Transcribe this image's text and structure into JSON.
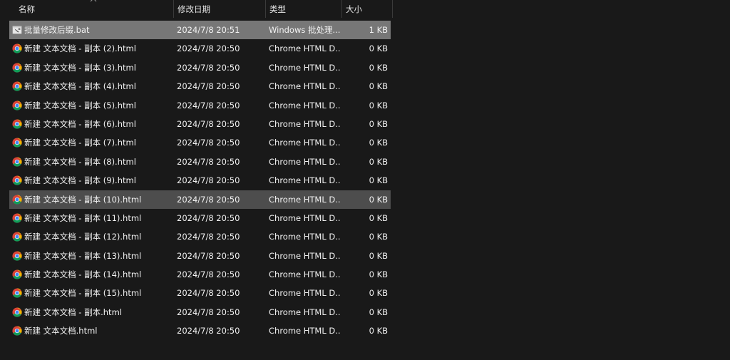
{
  "columns": {
    "name": "名称",
    "date": "修改日期",
    "type": "类型",
    "size": "大小"
  },
  "files": [
    {
      "name": "批量修改后缀.bat",
      "date": "2024/7/8 20:51",
      "type": "Windows 批处理...",
      "size": "1 KB",
      "icon": "bat-file-icon",
      "state": "selected"
    },
    {
      "name": "新建 文本文档 - 副本 (2).html",
      "date": "2024/7/8 20:50",
      "type": "Chrome HTML D...",
      "size": "0 KB",
      "icon": "chrome-icon",
      "state": "normal"
    },
    {
      "name": "新建 文本文档 - 副本 (3).html",
      "date": "2024/7/8 20:50",
      "type": "Chrome HTML D...",
      "size": "0 KB",
      "icon": "chrome-icon",
      "state": "normal"
    },
    {
      "name": "新建 文本文档 - 副本 (4).html",
      "date": "2024/7/8 20:50",
      "type": "Chrome HTML D...",
      "size": "0 KB",
      "icon": "chrome-icon",
      "state": "normal"
    },
    {
      "name": "新建 文本文档 - 副本 (5).html",
      "date": "2024/7/8 20:50",
      "type": "Chrome HTML D...",
      "size": "0 KB",
      "icon": "chrome-icon",
      "state": "normal"
    },
    {
      "name": "新建 文本文档 - 副本 (6).html",
      "date": "2024/7/8 20:50",
      "type": "Chrome HTML D...",
      "size": "0 KB",
      "icon": "chrome-icon",
      "state": "normal"
    },
    {
      "name": "新建 文本文档 - 副本 (7).html",
      "date": "2024/7/8 20:50",
      "type": "Chrome HTML D...",
      "size": "0 KB",
      "icon": "chrome-icon",
      "state": "normal"
    },
    {
      "name": "新建 文本文档 - 副本 (8).html",
      "date": "2024/7/8 20:50",
      "type": "Chrome HTML D...",
      "size": "0 KB",
      "icon": "chrome-icon",
      "state": "normal"
    },
    {
      "name": "新建 文本文档 - 副本 (9).html",
      "date": "2024/7/8 20:50",
      "type": "Chrome HTML D...",
      "size": "0 KB",
      "icon": "chrome-icon",
      "state": "normal"
    },
    {
      "name": "新建 文本文档 - 副本 (10).html",
      "date": "2024/7/8 20:50",
      "type": "Chrome HTML D...",
      "size": "0 KB",
      "icon": "chrome-icon",
      "state": "hover"
    },
    {
      "name": "新建 文本文档 - 副本 (11).html",
      "date": "2024/7/8 20:50",
      "type": "Chrome HTML D...",
      "size": "0 KB",
      "icon": "chrome-icon",
      "state": "normal"
    },
    {
      "name": "新建 文本文档 - 副本 (12).html",
      "date": "2024/7/8 20:50",
      "type": "Chrome HTML D...",
      "size": "0 KB",
      "icon": "chrome-icon",
      "state": "normal"
    },
    {
      "name": "新建 文本文档 - 副本 (13).html",
      "date": "2024/7/8 20:50",
      "type": "Chrome HTML D...",
      "size": "0 KB",
      "icon": "chrome-icon",
      "state": "normal"
    },
    {
      "name": "新建 文本文档 - 副本 (14).html",
      "date": "2024/7/8 20:50",
      "type": "Chrome HTML D...",
      "size": "0 KB",
      "icon": "chrome-icon",
      "state": "normal"
    },
    {
      "name": "新建 文本文档 - 副本 (15).html",
      "date": "2024/7/8 20:50",
      "type": "Chrome HTML D...",
      "size": "0 KB",
      "icon": "chrome-icon",
      "state": "normal"
    },
    {
      "name": "新建 文本文档 - 副本.html",
      "date": "2024/7/8 20:50",
      "type": "Chrome HTML D...",
      "size": "0 KB",
      "icon": "chrome-icon",
      "state": "normal"
    },
    {
      "name": "新建 文本文档.html",
      "date": "2024/7/8 20:50",
      "type": "Chrome HTML D...",
      "size": "0 KB",
      "icon": "chrome-icon",
      "state": "normal"
    }
  ]
}
